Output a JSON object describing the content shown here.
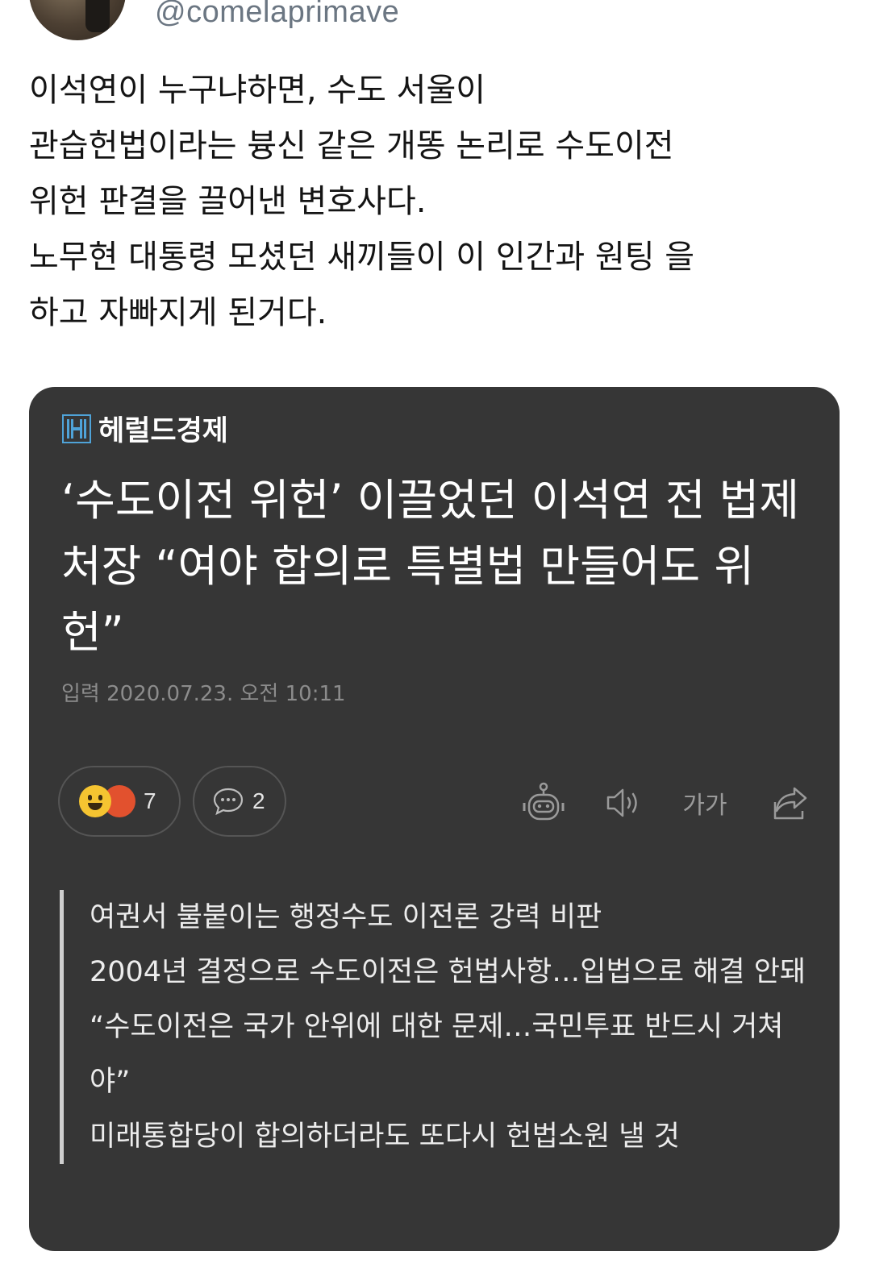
{
  "tweet": {
    "handle": "@comelaprimave",
    "text": "이석연이 누구냐하면, 수도 서울이\n관습헌법이라는 븅신 같은 개똥 논리로 수도이전\n위헌 판결을 끌어낸 변호사다.\n노무현 대통령 모셨던 새끼들이 이 인간과 원팅 을\n하고 자빠지게 된거다."
  },
  "card": {
    "publisher": "헤럴드경제",
    "headline": "‘수도이전 위헌’ 이끌었던 이석연 전 법제처장 “여야 합의로 특별법 만들어도 위헌”",
    "dateline": "입력 2020.07.23. 오전 10:11",
    "reactions": {
      "icons": [
        "smile-emoji-icon",
        "angry-emoji-icon"
      ],
      "count": "7"
    },
    "comments": {
      "icon": "comment-bubble-icon",
      "count": "2"
    },
    "toolbar": {
      "summary_bot_icon": "robot-icon",
      "audio_icon": "speaker-icon",
      "font_size_label": "가가",
      "share_icon": "share-icon"
    },
    "summary": [
      "여권서 불붙이는 행정수도 이전론 강력 비판",
      "2004년 결정으로 수도이전은 헌법사항…입법으로 해결 안돼",
      "“수도이전은 국가 안위에 대한 문제…국민투표 반드시 거쳐야”",
      "미래통합당이 합의하더라도 또다시 헌법소원 낼 것"
    ],
    "colors": {
      "background": "#363636",
      "logo_accent": "#4fa3d8"
    }
  }
}
